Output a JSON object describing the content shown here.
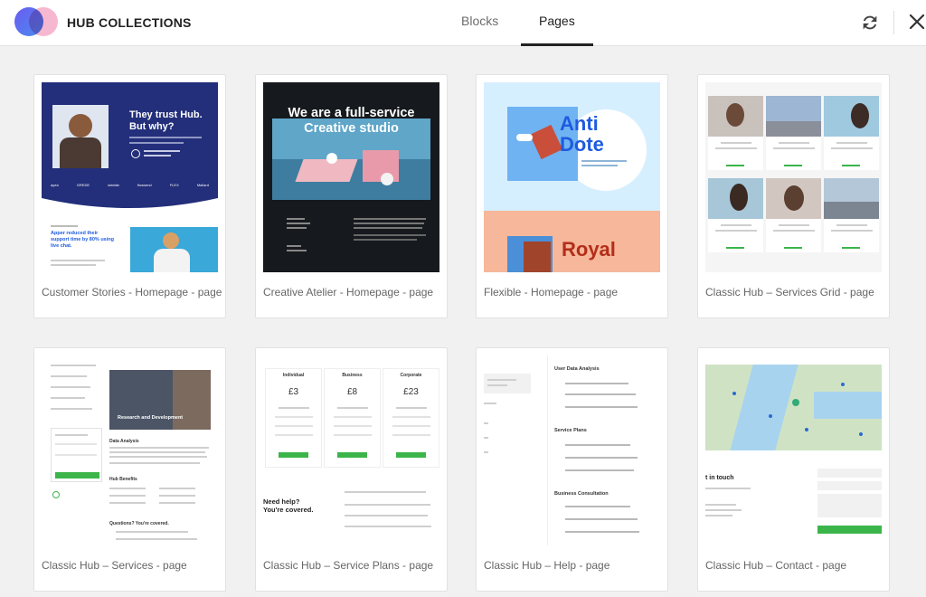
{
  "header": {
    "brand": "HUB COLLECTIONS",
    "tabs": [
      {
        "label": "Blocks",
        "active": false
      },
      {
        "label": "Pages",
        "active": true
      }
    ],
    "icons": {
      "logo": "hub-logo-icon",
      "refresh": "refresh-icon",
      "close": "close-icon"
    }
  },
  "colors": {
    "accent": "#222222",
    "green": "#3bb54a",
    "navy": "#232f7a",
    "blue": "#1e5be0"
  },
  "cards": [
    {
      "label": "Customer Stories - Homepage - page",
      "thumb": {
        "headline": "They trust Hub.",
        "headline2": "But why?",
        "logos": [
          "ayea",
          "GREDE",
          "wirelab",
          "flowsend",
          "FLEX",
          "Mallard"
        ],
        "subheading": "Apper reduced their support time by 80% using live chat."
      }
    },
    {
      "label": "Creative Atelier - Homepage - page",
      "thumb": {
        "headline": "We are a full-service",
        "headline2": "Creative studio"
      }
    },
    {
      "label": "Flexible - Homepage - page",
      "thumb": {
        "headline": "Anti",
        "headline2": "Dote",
        "headline3": "Royal"
      }
    },
    {
      "label": "Classic Hub – Services Grid - page",
      "thumb": {}
    },
    {
      "label": "Classic Hub – Services - page",
      "thumb": {
        "banner": "Research and Development",
        "section": "Data Analysis",
        "benefits": "Hub Benefits",
        "questions": "Questions? You're covered."
      }
    },
    {
      "label": "Classic Hub – Service Plans - page",
      "thumb": {
        "plans": [
          {
            "name": "Individual",
            "price": "£3"
          },
          {
            "name": "Business",
            "price": "£8"
          },
          {
            "name": "Corporate",
            "price": "£23"
          }
        ],
        "help": "Need help? You're covered."
      }
    },
    {
      "label": "Classic Hub – Help - page",
      "thumb": {
        "section1": "User Data Analysis",
        "section2": "Service Plans",
        "section3": "Business Consultation"
      }
    },
    {
      "label": "Classic Hub – Contact - page",
      "thumb": {
        "title": "t in touch"
      }
    }
  ]
}
